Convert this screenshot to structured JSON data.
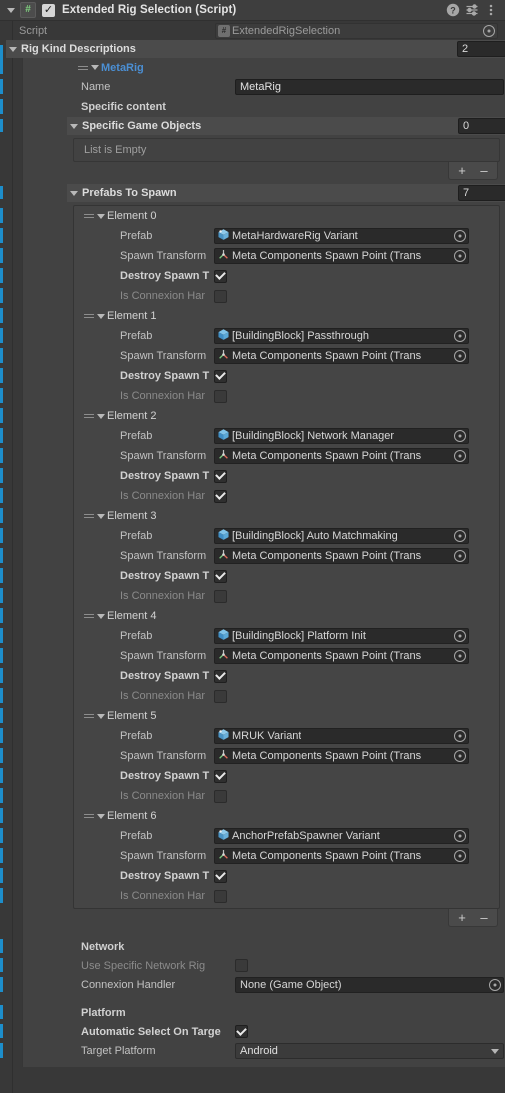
{
  "component": {
    "title": "Extended Rig Selection (Script)",
    "script_glyph": "#",
    "enabled_check": "✓",
    "help_icon": "help-icon",
    "preset_icon": "preset-icon",
    "menu_icon": "more-menu-icon"
  },
  "script_row": {
    "label": "Script",
    "value": "ExtendedRigSelection"
  },
  "rig_kind_descriptions": {
    "label": "Rig Kind Descriptions",
    "size": "2"
  },
  "rig": {
    "title": "MetaRig",
    "name_label": "Name",
    "name_value": "MetaRig",
    "specific_content_label": "Specific content",
    "specific_game_objects": {
      "label": "Specific Game Objects",
      "size": "0",
      "empty_text": "List is Empty",
      "add_label": "+",
      "remove_label": "–"
    },
    "prefabs_to_spawn": {
      "label": "Prefabs To Spawn",
      "size": "7",
      "add_label": "+",
      "remove_label": "–",
      "field_labels": {
        "prefab": "Prefab",
        "spawn_transform": "Spawn Transform",
        "destroy_spawn": "Destroy Spawn T",
        "is_connexion_handler": "Is Connexion Har"
      },
      "elements": [
        {
          "title": "Element 0",
          "prefab": "MetaHardwareRig Variant",
          "prefab_icon": "prefab-variant-icon",
          "spawn_transform": "Meta Components Spawn Point (Trans",
          "spawn_transform_icon": "transform-icon",
          "destroy_spawn": true,
          "is_connexion_handler": false
        },
        {
          "title": "Element 1",
          "prefab": "[BuildingBlock] Passthrough",
          "prefab_icon": "prefab-icon",
          "spawn_transform": "Meta Components Spawn Point (Trans",
          "spawn_transform_icon": "transform-icon",
          "destroy_spawn": true,
          "is_connexion_handler": false
        },
        {
          "title": "Element 2",
          "prefab": "[BuildingBlock] Network Manager",
          "prefab_icon": "prefab-icon",
          "spawn_transform": "Meta Components Spawn Point (Trans",
          "spawn_transform_icon": "transform-icon",
          "destroy_spawn": true,
          "is_connexion_handler": true
        },
        {
          "title": "Element 3",
          "prefab": "[BuildingBlock] Auto Matchmaking",
          "prefab_icon": "prefab-icon",
          "spawn_transform": "Meta Components Spawn Point (Trans",
          "spawn_transform_icon": "transform-icon",
          "destroy_spawn": true,
          "is_connexion_handler": false
        },
        {
          "title": "Element 4",
          "prefab": "[BuildingBlock] Platform Init",
          "prefab_icon": "prefab-icon",
          "spawn_transform": "Meta Components Spawn Point (Trans",
          "spawn_transform_icon": "transform-icon",
          "destroy_spawn": true,
          "is_connexion_handler": false
        },
        {
          "title": "Element 5",
          "prefab": "MRUK Variant",
          "prefab_icon": "prefab-variant-icon",
          "spawn_transform": "Meta Components Spawn Point (Trans",
          "spawn_transform_icon": "transform-icon",
          "destroy_spawn": true,
          "is_connexion_handler": false
        },
        {
          "title": "Element 6",
          "prefab": "AnchorPrefabSpawner Variant",
          "prefab_icon": "prefab-variant-icon",
          "spawn_transform": "Meta Components Spawn Point (Trans",
          "spawn_transform_icon": "transform-icon",
          "destroy_spawn": true,
          "is_connexion_handler": false
        }
      ]
    },
    "network": {
      "header": "Network",
      "use_specific_network_rig_label": "Use Specific Network Rig",
      "use_specific_network_rig": false,
      "connexion_handler_label": "Connexion Handler",
      "connexion_handler_value": "None (Game Object)"
    },
    "platform": {
      "header": "Platform",
      "automatic_select_label": "Automatic Select On Targe",
      "automatic_select": true,
      "target_platform_label": "Target Platform",
      "target_platform_value": "Android"
    }
  },
  "colors": {
    "background": "#383838",
    "header": "#3e3e3e",
    "list_header": "#4b4b4b",
    "element_box": "#454545",
    "field": "#2a2a2a",
    "accent_blue": "#1d8ecb",
    "link_blue": "#4b8fd4"
  }
}
